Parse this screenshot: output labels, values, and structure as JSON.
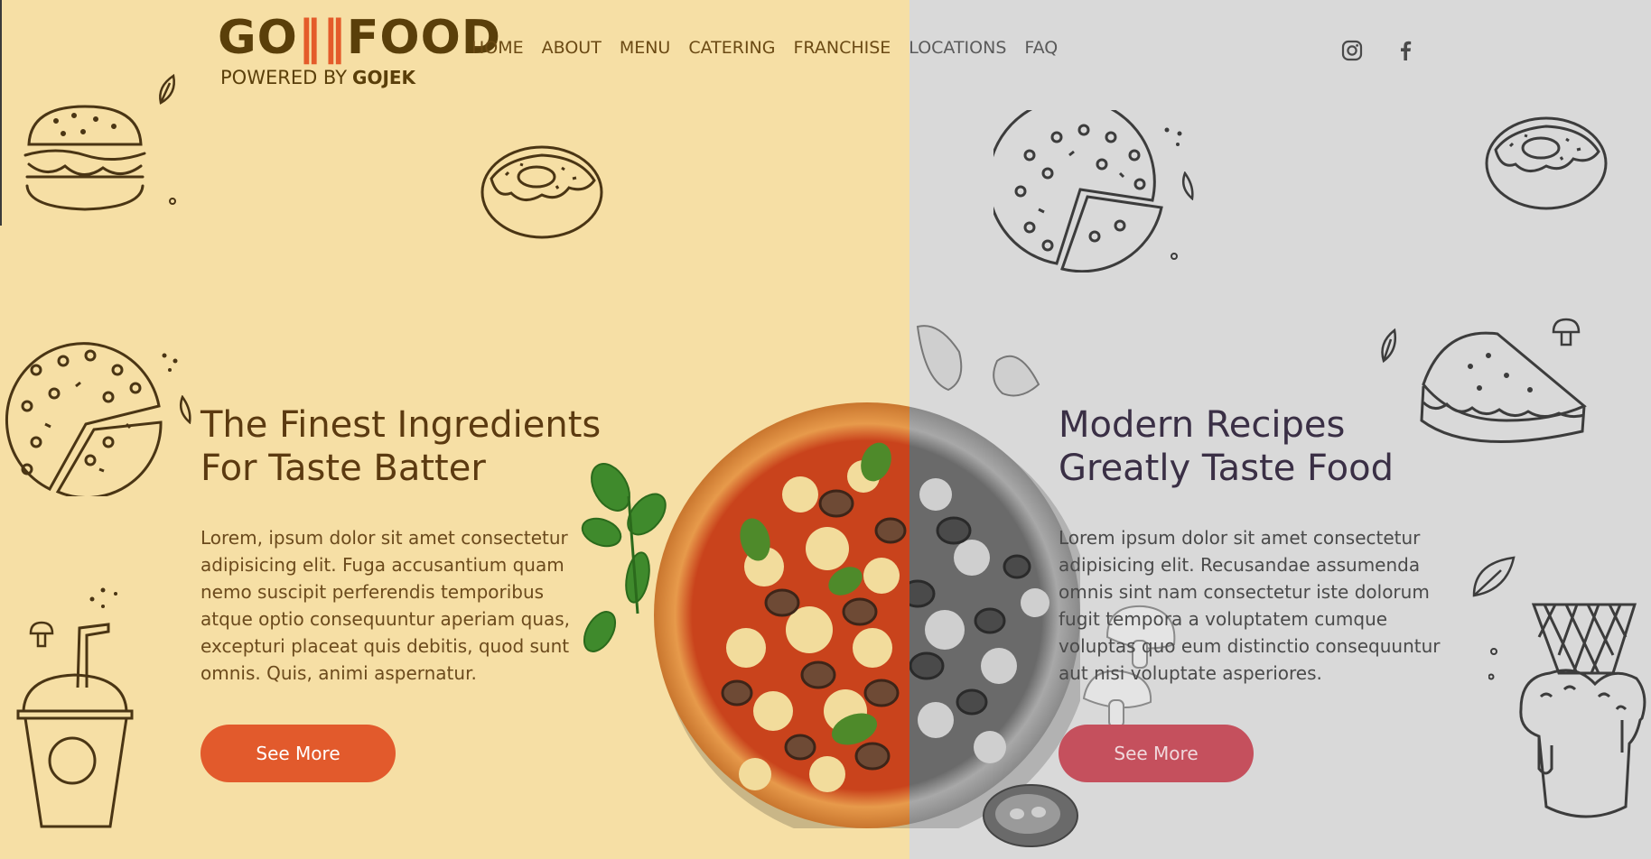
{
  "brand": {
    "logo_main_left": "GO",
    "logo_main_right": "FOOD",
    "logo_powered": "POWERED BY",
    "logo_partner": "GOJEK"
  },
  "nav": {
    "items": [
      "HOME",
      "ABOUT",
      "MENU",
      "CATERING",
      "FRANCHISE",
      "LOCATIONS",
      "FAQ"
    ]
  },
  "social": {
    "icons": [
      "instagram-icon",
      "facebook-icon"
    ]
  },
  "left_panel": {
    "headline_line1": "The Finest Ingredients",
    "headline_line2": "For Taste Batter",
    "body": "Lorem, ipsum dolor sit amet consectetur adipisicing elit. Fuga accusantium quam nemo suscipit perferendis temporibus atque optio consequuntur aperiam quas, excepturi placeat quis debitis, quod sunt omnis. Quis, animi aspernatur.",
    "button_label": "See More"
  },
  "right_panel": {
    "headline_line1": "Modern Recipes",
    "headline_line2": "Greatly Taste Food",
    "body": "Lorem ipsum dolor sit amet consectetur adipisicing elit. Recusandae assumenda omnis sint nam consectetur iste dolorum fugit tempora a voluptatem cumque voluptas quo eum distinctio consequuntur aut nisi voluptate asperiores.",
    "button_label": "See More"
  },
  "colors": {
    "left_bg": "#f6dfa5",
    "right_bg": "#d9d9d9",
    "left_button": "#e25a2c",
    "right_button": "#c5505d",
    "left_text": "#5b3a10",
    "right_text": "#3a2f45",
    "doodle_line": "#4a3514"
  },
  "doodles_left": [
    "burger-doodle-icon",
    "leaf-icon",
    "donut-doodle-icon",
    "pizza-doodle-icon",
    "cup-doodle-icon",
    "mushroom-doodle-icon"
  ],
  "doodles_right": [
    "pizza-doodle-icon",
    "donut-doodle-icon",
    "sandwich-doodle-icon",
    "mushroom-doodle-icon",
    "ice-cream-doodle-icon",
    "leaf-icon"
  ]
}
